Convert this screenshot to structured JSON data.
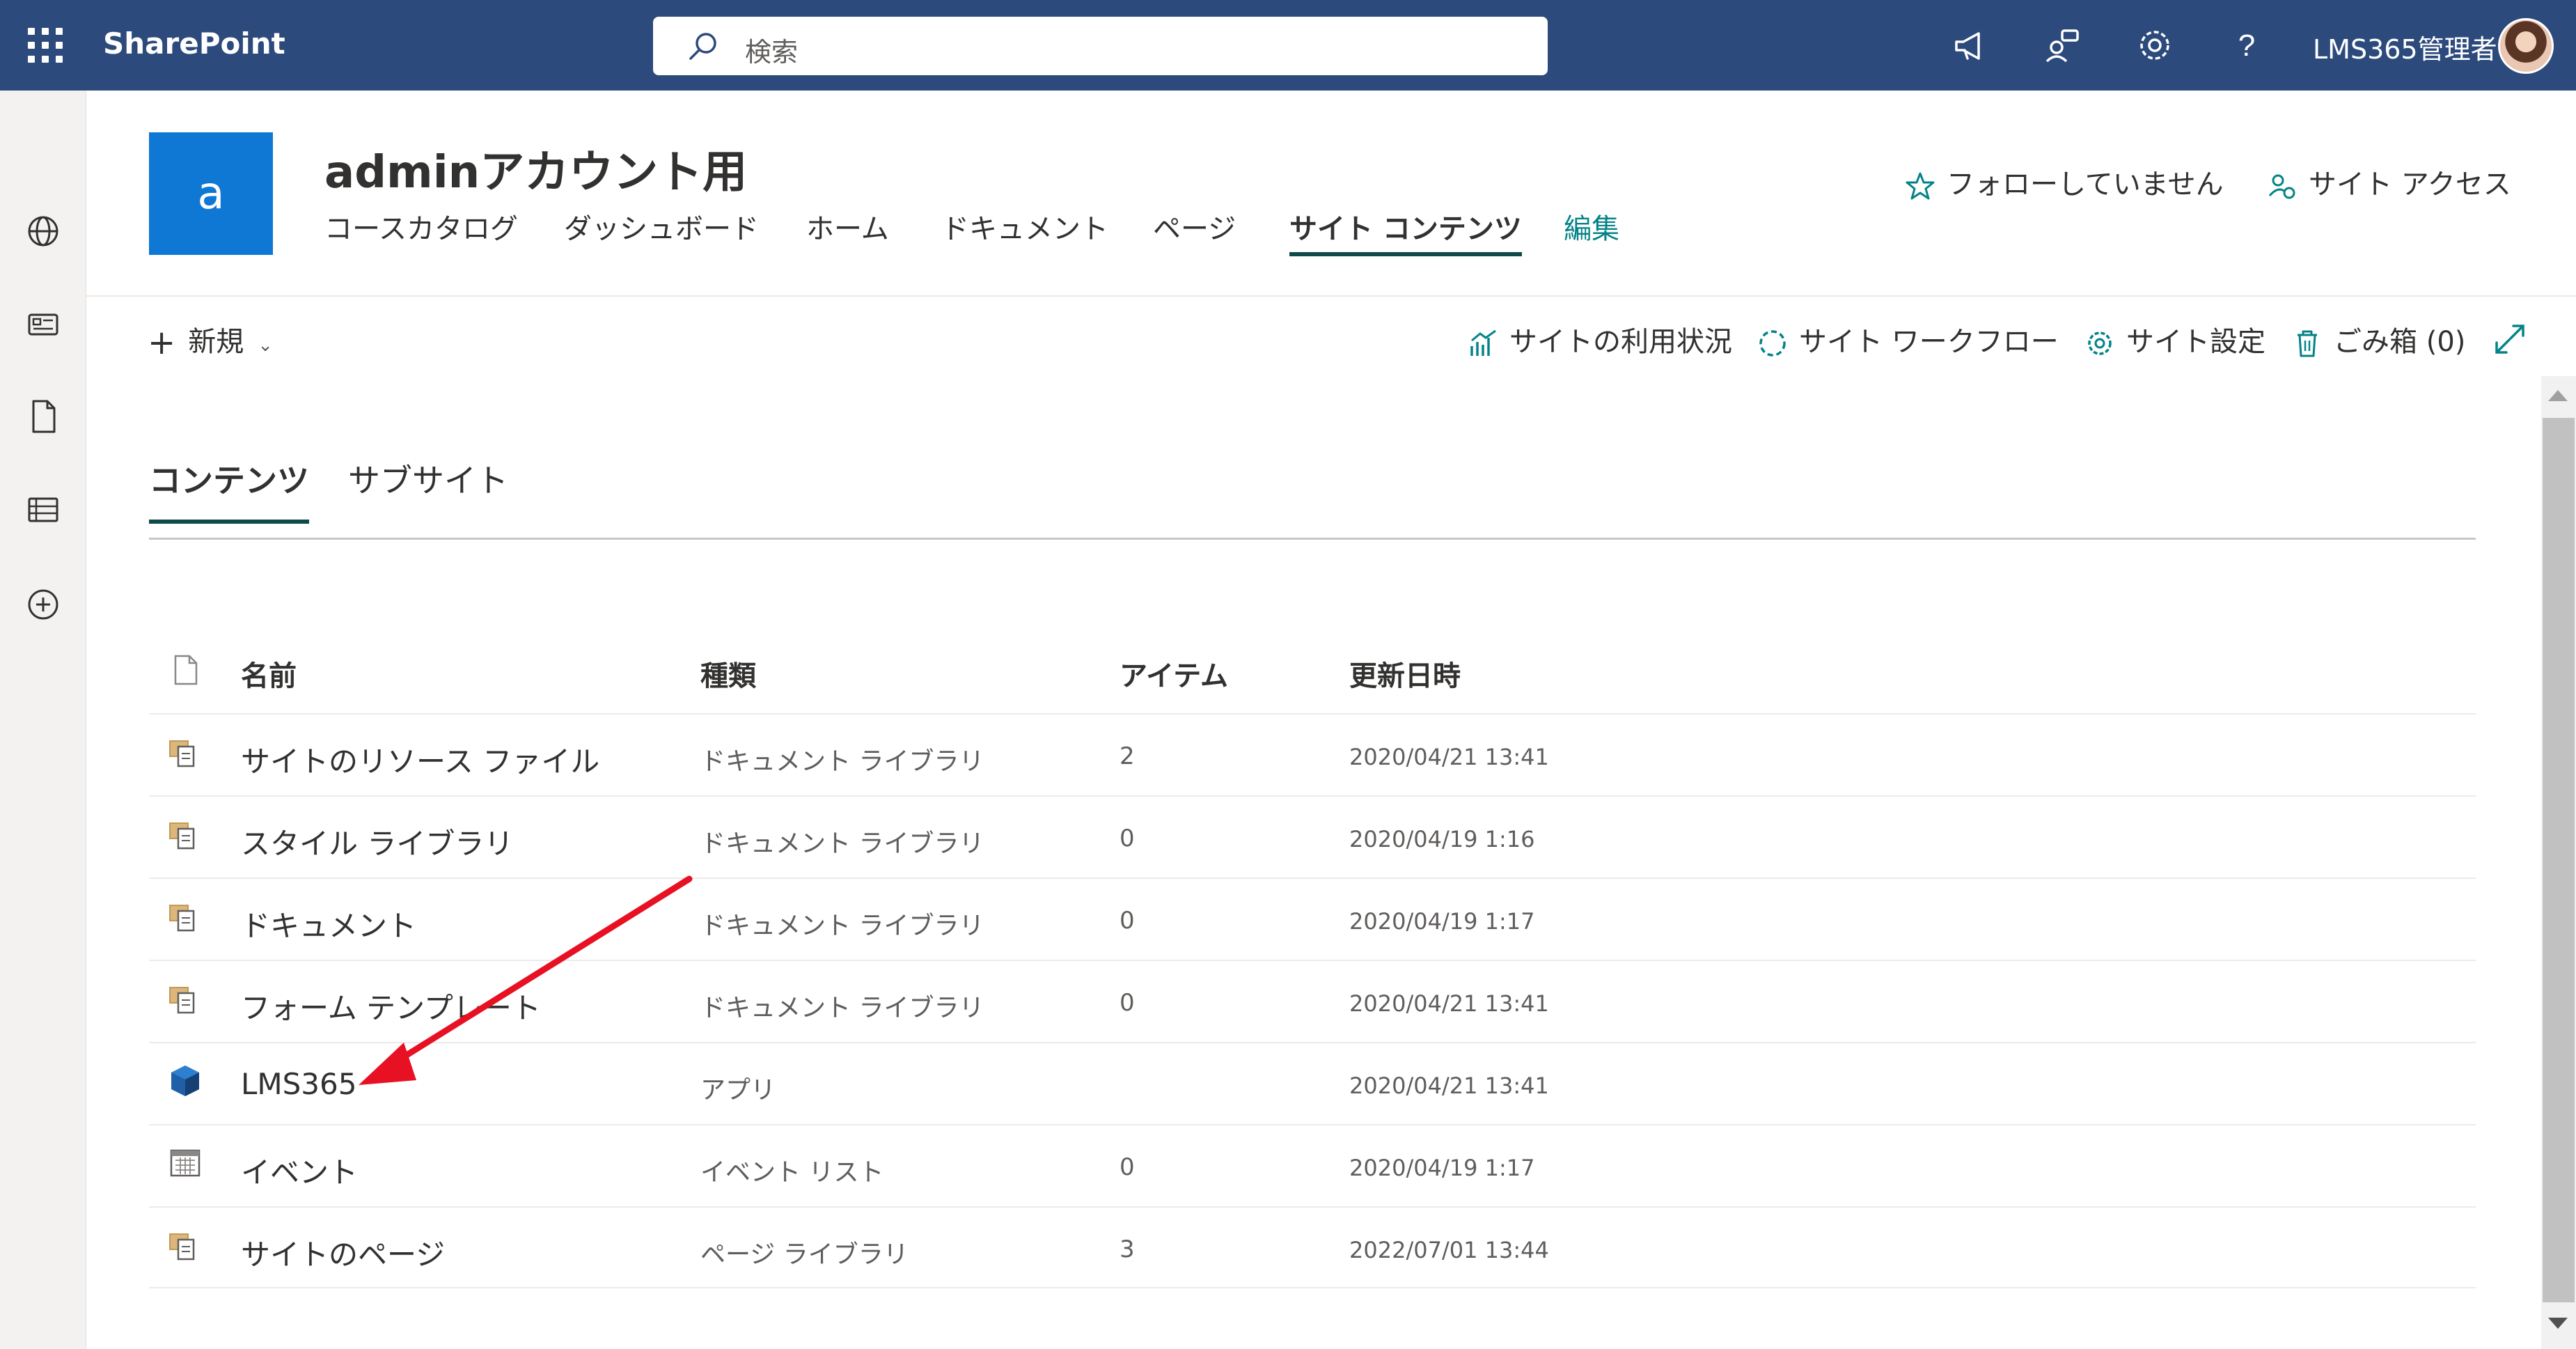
{
  "suite_bar": {
    "brand": "SharePoint",
    "search_placeholder": "検索",
    "user_name": "LMS365管理者",
    "icons": [
      "waffle-icon",
      "megaphone-icon",
      "share-people-icon",
      "settings-gear-icon",
      "help-icon"
    ]
  },
  "left_rail": {
    "icons": [
      "globe-icon",
      "news-icon",
      "document-icon",
      "list-icon",
      "add-circle-icon"
    ]
  },
  "site": {
    "logo_letter": "a",
    "title": "adminアカウント用",
    "nav": [
      {
        "label": "コースカタログ",
        "active": false
      },
      {
        "label": "ダッシュボード",
        "active": false
      },
      {
        "label": "ホーム",
        "active": false
      },
      {
        "label": "ドキュメント",
        "active": false
      },
      {
        "label": "ページ",
        "active": false
      },
      {
        "label": "サイト コンテンツ",
        "active": true
      },
      {
        "label": "編集",
        "active": false
      }
    ],
    "follow_label": "フォローしていません",
    "site_access_label": "サイト アクセス"
  },
  "command_bar": {
    "new_label": "新規",
    "usage_label": "サイトの利用状況",
    "workflow_label": "サイト ワークフロー",
    "settings_label": "サイト設定",
    "recycle_label": "ごみ箱 (0)"
  },
  "tabs": {
    "contents": "コンテンツ",
    "subsites": "サブサイト"
  },
  "table": {
    "headers": {
      "name": "名前",
      "type": "種類",
      "items": "アイテム",
      "modified": "更新日時"
    },
    "rows": [
      {
        "icon": "library-icon",
        "name": "サイトのリソース ファイル",
        "type": "ドキュメント ライブラリ",
        "items": "2",
        "modified": "2020/04/21 13:41"
      },
      {
        "icon": "library-icon",
        "name": "スタイル ライブラリ",
        "type": "ドキュメント ライブラリ",
        "items": "0",
        "modified": "2020/04/19 1:16"
      },
      {
        "icon": "library-icon",
        "name": "ドキュメント",
        "type": "ドキュメント ライブラリ",
        "items": "0",
        "modified": "2020/04/19 1:17"
      },
      {
        "icon": "library-icon",
        "name": "フォーム テンプレート",
        "type": "ドキュメント ライブラリ",
        "items": "0",
        "modified": "2020/04/21 13:41"
      },
      {
        "icon": "app-cube-icon",
        "name": "LMS365",
        "type": "アプリ",
        "items": "",
        "modified": "2020/04/21 13:41"
      },
      {
        "icon": "calendar-icon",
        "name": "イベント",
        "type": "イベント リスト",
        "items": "0",
        "modified": "2020/04/19 1:17"
      },
      {
        "icon": "library-icon",
        "name": "サイトのページ",
        "type": "ページ ライブラリ",
        "items": "3",
        "modified": "2022/07/01 13:44"
      }
    ]
  },
  "colors": {
    "suite_bar": "#2c4a7c",
    "site_logo": "#0f78d4",
    "accent": "#038387",
    "annotation_arrow": "#e81123"
  }
}
